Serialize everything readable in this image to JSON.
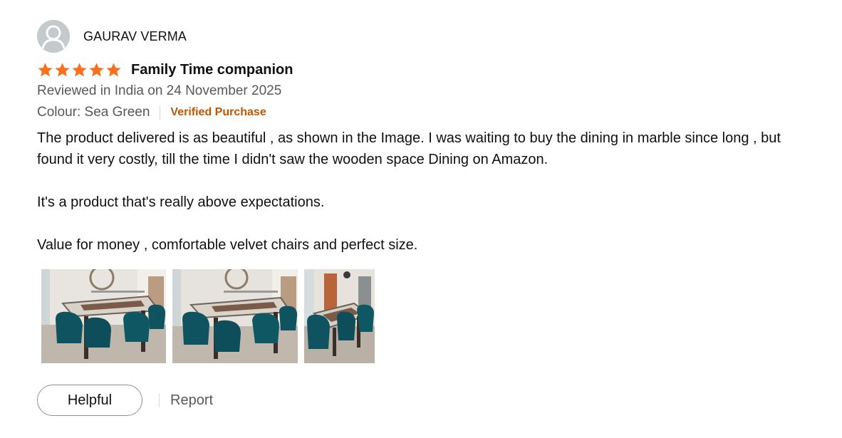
{
  "review": {
    "reviewer_name": "GAURAV VERMA",
    "avatar_icon": "default-avatar-icon",
    "rating": 5,
    "rating_max": 5,
    "star_color": "#f7711d",
    "title": "Family Time companion",
    "date_line": "Reviewed in India on 24 November 2025",
    "format": "Colour: Sea Green",
    "verified_label": "Verified Purchase",
    "verified_color": "#c45500",
    "body_paragraphs": [
      "The product delivered is as beautiful , as shown in the Image. I was waiting to buy the dining in marble since long , but found it very costly, till the time I didn't saw the wooden space Dining on Amazon.",
      "It's a product that's really above expectations.",
      "Value for money , comfortable velvet chairs and perfect size."
    ],
    "images_count": 3,
    "helpful_label": "Helpful",
    "report_label": "Report"
  }
}
